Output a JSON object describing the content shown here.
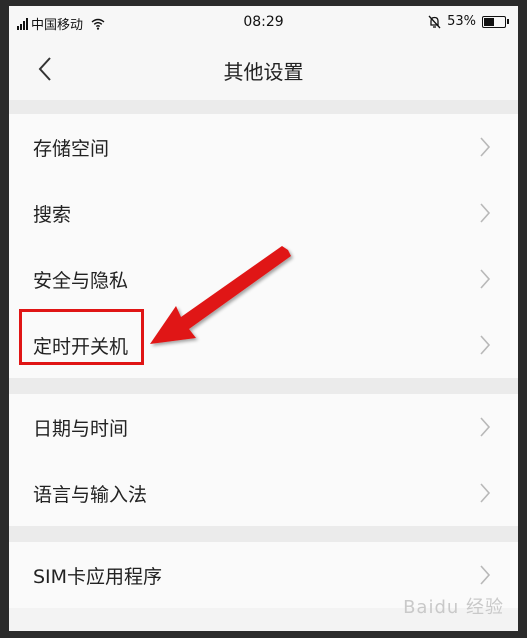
{
  "status_bar": {
    "carrier": "中国移动",
    "time": "08:29",
    "battery": "53%",
    "battery_level": 0.53
  },
  "header": {
    "title": "其他设置",
    "back_icon": "chevron-left-icon"
  },
  "groups": [
    {
      "items": [
        {
          "label": "存储空间"
        },
        {
          "label": "搜索"
        },
        {
          "label": "安全与隐私"
        },
        {
          "label": "定时开关机",
          "highlighted": true
        }
      ]
    },
    {
      "items": [
        {
          "label": "日期与时间"
        },
        {
          "label": "语言与输入法"
        }
      ]
    },
    {
      "items": [
        {
          "label": "SIM卡应用程序"
        }
      ]
    }
  ],
  "annotation": {
    "highlight_color": "#e01515",
    "arrow_color": "#e01515"
  },
  "watermark": "Baidu 经验"
}
